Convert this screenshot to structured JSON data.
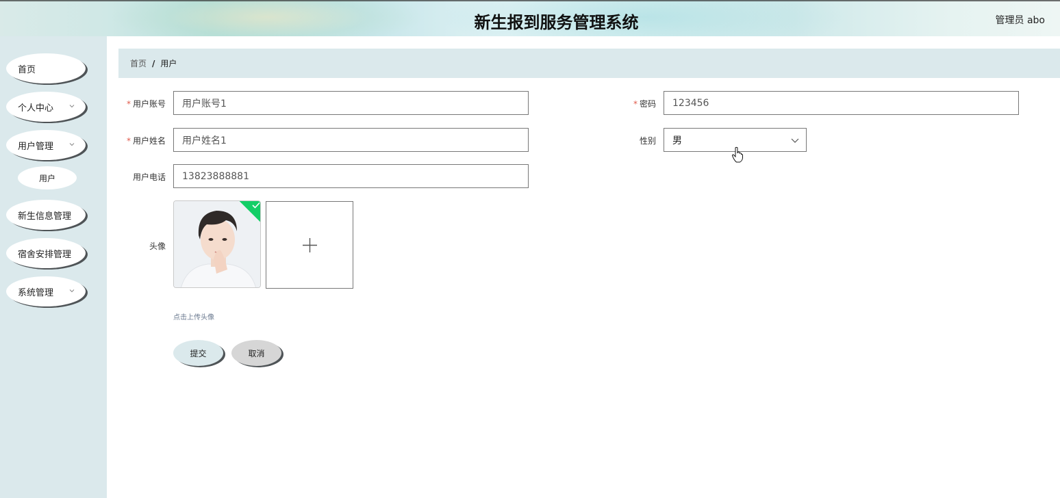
{
  "header": {
    "title": "新生报到服务管理系统",
    "user": "管理员 abo"
  },
  "sidebar": {
    "items": [
      {
        "label": "首页"
      },
      {
        "label": "个人中心"
      },
      {
        "label": "用户管理"
      },
      {
        "label": "用户"
      },
      {
        "label": "新生信息管理"
      },
      {
        "label": "宿舍安排管理"
      },
      {
        "label": "系统管理"
      }
    ]
  },
  "breadcrumb": {
    "home": "首页",
    "separator": "/",
    "current": "用户"
  },
  "form": {
    "required_mark": "*",
    "account_label": "用户账号",
    "account_value": "用户账号1",
    "password_label": "密码",
    "password_value": "123456",
    "name_label": "用户姓名",
    "name_value": "用户姓名1",
    "gender_label": "性别",
    "gender_value": "男",
    "phone_label": "用户电话",
    "phone_value": "13823888881",
    "avatar_label": "头像",
    "upload_plus": "+",
    "upload_hint": "点击上传头像",
    "submit_label": "提交",
    "cancel_label": "取消"
  },
  "colors": {
    "accent": "#dbe9ec",
    "check_badge": "#13ce66",
    "required": "#e05a4c"
  }
}
